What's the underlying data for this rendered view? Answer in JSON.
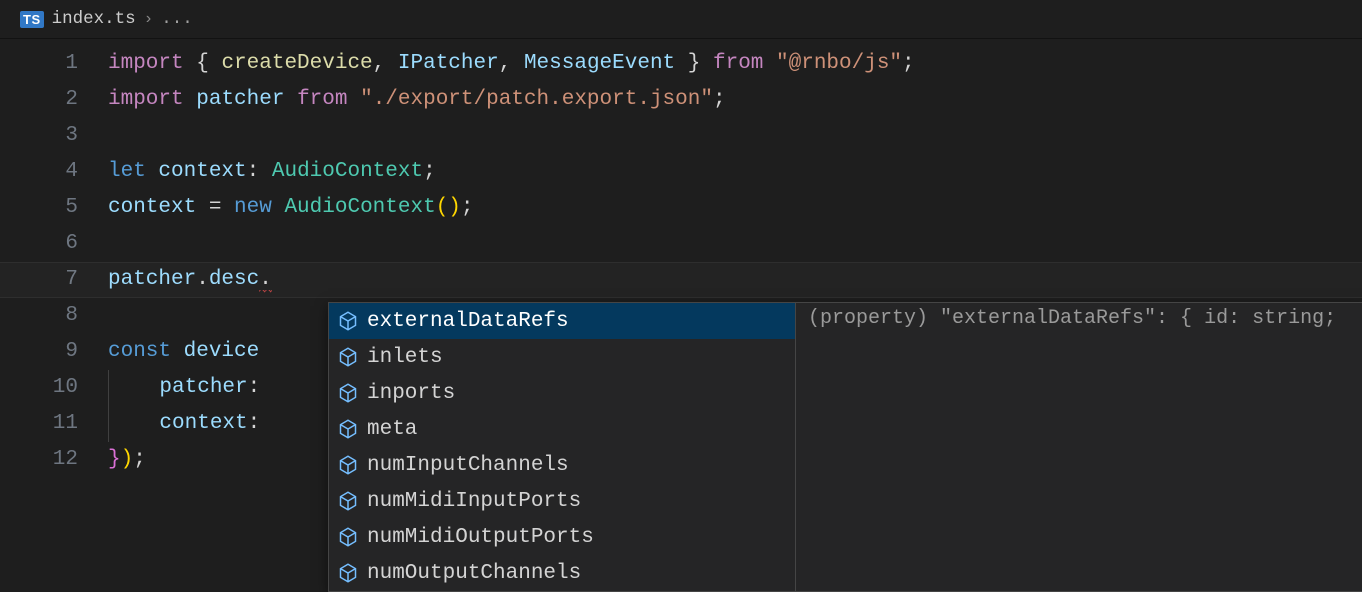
{
  "breadcrumb": {
    "ts_badge": "TS",
    "filename": "index.ts",
    "chevron": "›",
    "ellipsis": "..."
  },
  "gutter": {
    "lines": [
      "1",
      "2",
      "3",
      "4",
      "5",
      "6",
      "7",
      "8",
      "9",
      "10",
      "11",
      "12"
    ]
  },
  "code": {
    "line1": {
      "import": "import",
      "lbrace": " { ",
      "createDevice": "createDevice",
      "c1": ", ",
      "IPatcher": "IPatcher",
      "c2": ", ",
      "MessageEvent": "MessageEvent",
      "rbrace": " } ",
      "from": "from",
      "sp": " ",
      "str": "\"@rnbo/js\"",
      "semi": ";"
    },
    "line2": {
      "import": "import",
      "sp1": " ",
      "patcher": "patcher",
      "sp2": " ",
      "from": "from",
      "sp3": " ",
      "str": "\"./export/patch.export.json\"",
      "semi": ";"
    },
    "line4": {
      "let": "let",
      "sp1": " ",
      "context": "context",
      "colon": ": ",
      "type": "AudioContext",
      "semi": ";"
    },
    "line5": {
      "context": "context",
      "eq": " = ",
      "new": "new",
      "sp": " ",
      "type": "AudioContext",
      "paren": "()",
      "semi": ";"
    },
    "line7": {
      "patcher": "patcher",
      "dot1": ".",
      "desc": "desc",
      "dot2": "."
    },
    "line9": {
      "const": "const",
      "sp": " ",
      "device": "device",
      "sp2": " "
    },
    "line10": {
      "indent": "    ",
      "patcher": "patcher",
      "colon": ": "
    },
    "line11": {
      "indent": "    ",
      "context": "context",
      "colon": ": "
    },
    "line12": {
      "rbrace": "}",
      "rparen": ")",
      "semi": ";"
    }
  },
  "autocomplete": {
    "items": [
      "externalDataRefs",
      "inlets",
      "inports",
      "meta",
      "numInputChannels",
      "numMidiInputPorts",
      "numMidiOutputPorts",
      "numOutputChannels"
    ],
    "selected_index": 0,
    "detail": "(property) \"externalDataRefs\": { id: string; "
  },
  "colors": {
    "background": "#1e1e1e",
    "autocomplete_bg": "#252526",
    "autocomplete_selected": "#04395e",
    "keyword_magenta": "#c586c0",
    "function_yellow": "#dcdcaa",
    "identifier": "#9cdcfe",
    "type": "#4ec9b0",
    "string": "#ce9178",
    "keyword_blue": "#569cd6"
  }
}
